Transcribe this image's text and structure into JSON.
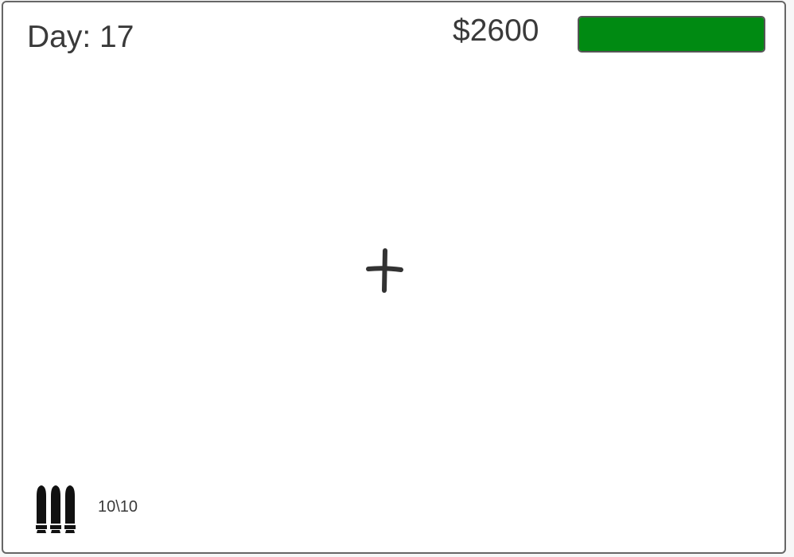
{
  "hud": {
    "day_text": "Day: 17",
    "money_text": "$2600",
    "health_fraction": 1.0,
    "health_color": "#008a12",
    "ammo_text": "10\\10",
    "ammo_icon": "bullets-icon",
    "crosshair_icon": "crosshair-icon"
  }
}
